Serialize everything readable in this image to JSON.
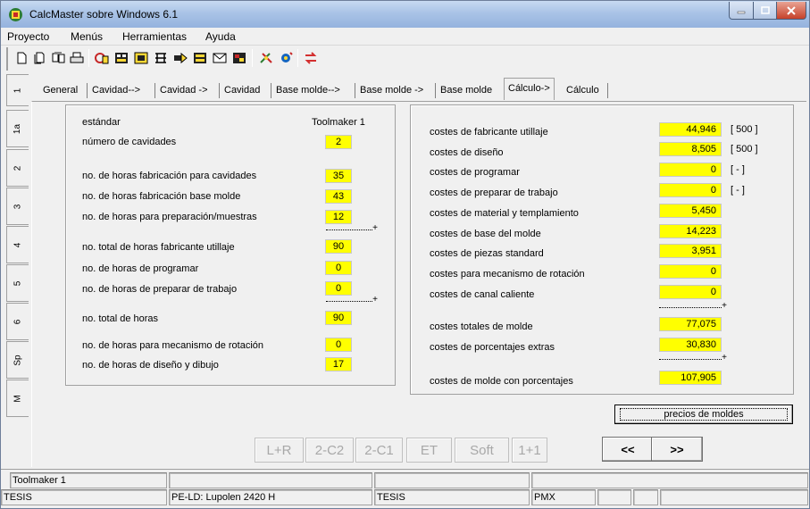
{
  "window": {
    "title": "CalcMaster sobre Windows 6.1"
  },
  "menu": [
    "Proyecto",
    "Menús",
    "Herramientas",
    "Ayuda"
  ],
  "vertical_tabs": [
    "1",
    "1a",
    "2",
    "3",
    "4",
    "5",
    "6",
    "Sp",
    "M"
  ],
  "tabs": [
    "General",
    "Cavidad-->",
    "Cavidad ->",
    "Cavidad",
    "Base molde-->",
    "Base molde ->",
    "Base molde",
    "Cálculo->",
    "Cálculo"
  ],
  "active_tab_index": 7,
  "left_panel": {
    "label_standard": "estándar",
    "column_header": "Toolmaker 1",
    "rows": [
      {
        "label": "número de cavidades",
        "value": "2"
      },
      {
        "label": "no. de horas fabricación para cavidades",
        "value": "35"
      },
      {
        "label": "no. de horas fabricación base molde",
        "value": "43"
      },
      {
        "label": "no. de horas para preparación/muestras",
        "value": "12"
      },
      {
        "label": "no. total de horas fabricante utillaje",
        "value": "90"
      },
      {
        "label": "no. de horas de programar",
        "value": "0"
      },
      {
        "label": "no. de horas de preparar de trabajo",
        "value": "0"
      },
      {
        "label": "no. total de horas",
        "value": "90"
      },
      {
        "label": "no. de horas para mecanismo de rotación",
        "value": "0"
      },
      {
        "label": "no. de horas de diseño y dibujo",
        "value": "17"
      }
    ]
  },
  "right_panel": {
    "rows": [
      {
        "label": "costes de fabricante utillaje",
        "value": "44,946",
        "unit": "[ 500 ]"
      },
      {
        "label": "costes de diseño",
        "value": "8,505",
        "unit": "[ 500 ]"
      },
      {
        "label": "costes de programar",
        "value": "0",
        "unit": "[ - ]"
      },
      {
        "label": "costes de preparar de trabajo",
        "value": "0",
        "unit": "[ - ]"
      },
      {
        "label": "costes de material y templamiento",
        "value": "5,450",
        "unit": ""
      },
      {
        "label": "costes de base del molde",
        "value": "14,223",
        "unit": ""
      },
      {
        "label": "costes de piezas standard",
        "value": "3,951",
        "unit": ""
      },
      {
        "label": "costes para mecanismo de rotación",
        "value": "0",
        "unit": ""
      },
      {
        "label": "costes de canal caliente",
        "value": "0",
        "unit": ""
      },
      {
        "label": "costes totales de molde",
        "value": "77,075",
        "unit": ""
      },
      {
        "label": "costes de porcentajes extras",
        "value": "30,830",
        "unit": ""
      },
      {
        "label": "costes de molde con porcentajes",
        "value": "107,905",
        "unit": ""
      }
    ]
  },
  "buttons": {
    "precios": "precios de moldes",
    "disabled": [
      "L+R",
      "2-C2",
      "2-C1",
      "ET",
      "Soft",
      "1+1"
    ],
    "prev": "<<",
    "next": ">>"
  },
  "status": {
    "row1": [
      "Toolmaker 1",
      "",
      "",
      "",
      ""
    ],
    "row2": [
      "TESIS",
      "PE-LD: Lupolen 2420 H",
      "TESIS",
      "PMX",
      "",
      "",
      ""
    ]
  },
  "colors": {
    "value_field": "#ffff00",
    "title_bar": "#a9c3e6",
    "close_button": "#c6412a"
  }
}
